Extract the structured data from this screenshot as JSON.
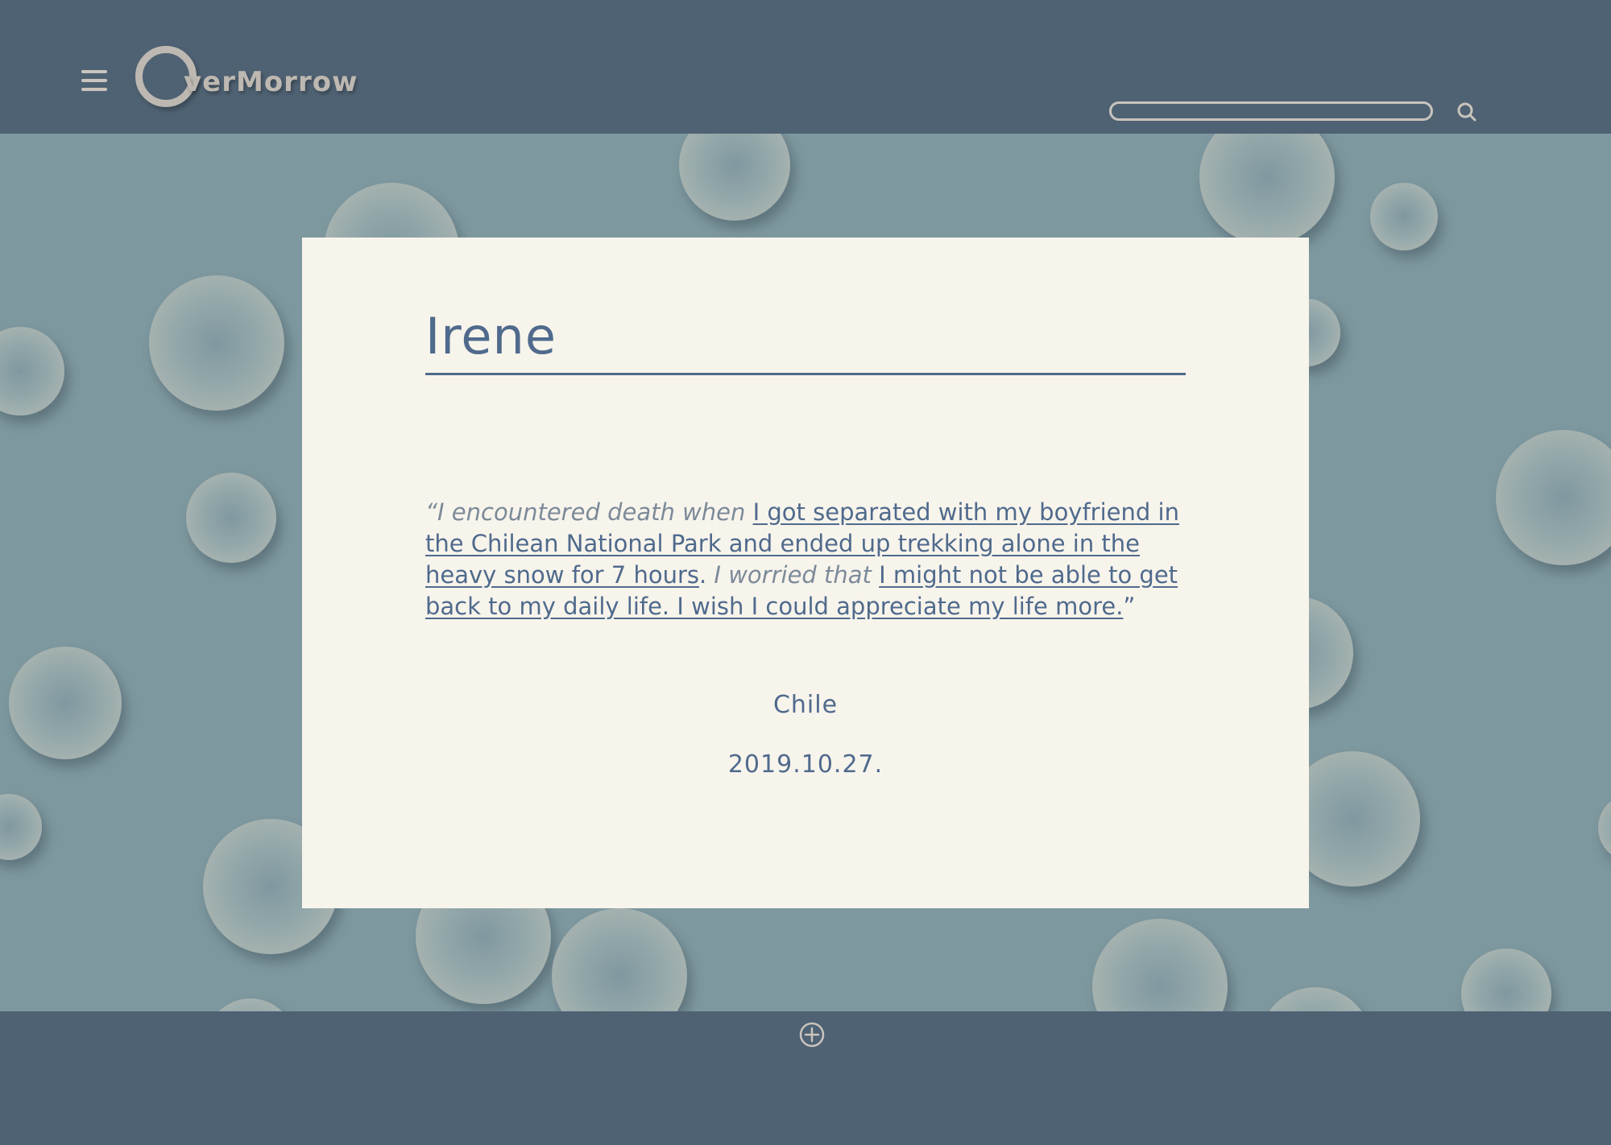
{
  "header": {
    "logo_text": "verMorrow",
    "search": {
      "placeholder": "",
      "value": ""
    },
    "icons": {
      "menu": "hamburger-menu-icon",
      "search": "search-icon"
    }
  },
  "card": {
    "name": "Irene",
    "quote": {
      "open_mark": "“",
      "intro": "I encountered death when ",
      "story": "I got separated with my boyfriend in the Chilean National Park and ended up trekking alone in the heavy snow for 7 hours",
      "period": ".",
      "worry_intro": " I worried that ",
      "worry": "I might not be able to get back to my daily life. I wish I could appreciate my life more.",
      "close_mark": "”"
    },
    "country": "Chile",
    "date": "2019.10.27."
  },
  "footer": {
    "icons": {
      "add": "add-circle-icon"
    }
  },
  "colors": {
    "header_bg": "#4f6273",
    "page_bg": "#7e989f",
    "card_bg": "#f7f4ec",
    "accent_text": "#4f6a8c",
    "muted_italic": "#7c8a99",
    "logo": "#bdb8b1"
  }
}
